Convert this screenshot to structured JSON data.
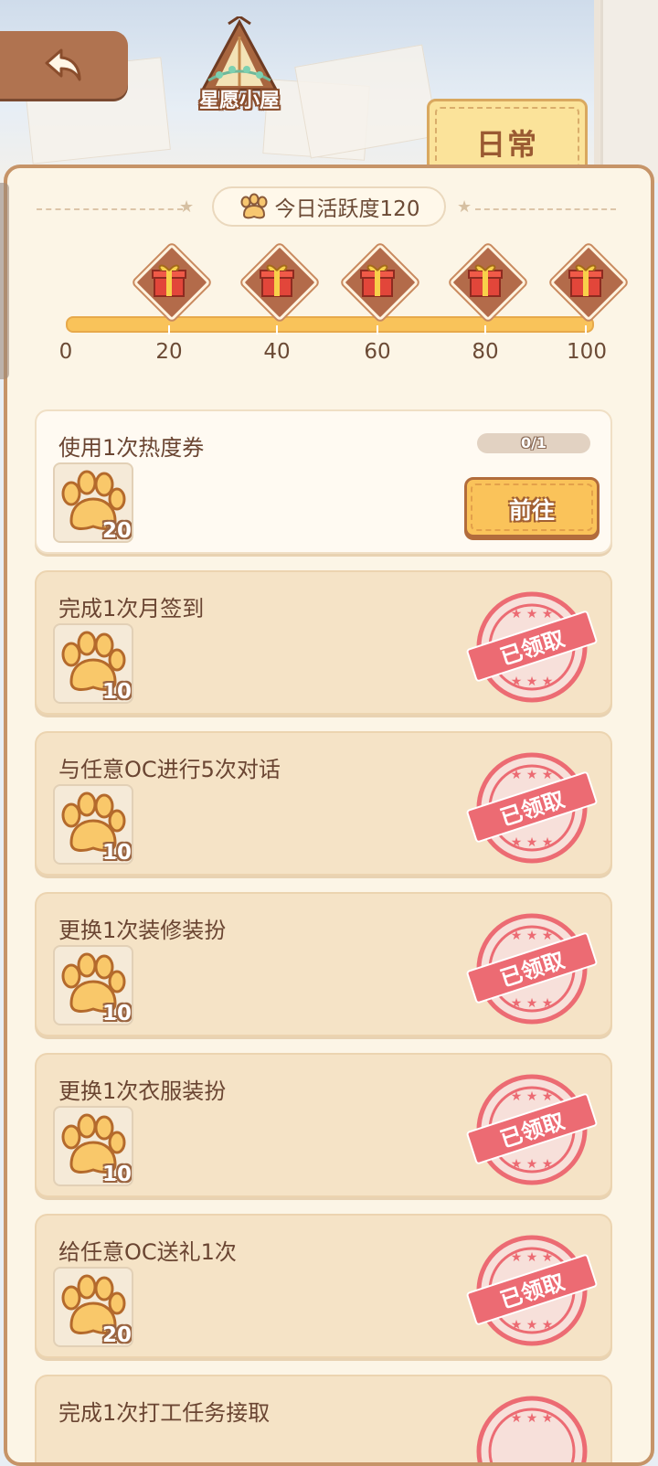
{
  "header": {
    "back_icon": "back-arrow-icon",
    "logo_text": "星愿小屋",
    "tab_label": "日常"
  },
  "activity": {
    "label": "今日活跃度120",
    "progress": 1.0,
    "milestones": [
      "20",
      "40",
      "60",
      "80",
      "100"
    ],
    "start_label": "0"
  },
  "tasks": [
    {
      "title": "使用1次热度券",
      "reward": "20",
      "status": "active",
      "progress": "0/1",
      "button": "前往"
    },
    {
      "title": "完成1次月签到",
      "reward": "10",
      "status": "claimed",
      "stamp": "已领取"
    },
    {
      "title": "与任意OC进行5次对话",
      "reward": "10",
      "status": "claimed",
      "stamp": "已领取"
    },
    {
      "title": "更换1次装修装扮",
      "reward": "10",
      "status": "claimed",
      "stamp": "已领取"
    },
    {
      "title": "更换1次衣服装扮",
      "reward": "10",
      "status": "claimed",
      "stamp": "已领取"
    },
    {
      "title": "给任意OC送礼1次",
      "reward": "20",
      "status": "claimed",
      "stamp": "已领取"
    },
    {
      "title": "完成1次打工任务接取",
      "reward": "",
      "status": "claimed",
      "stamp": ""
    }
  ],
  "colors": {
    "panel_bg": "#fcf5e6",
    "accent": "#fac35a",
    "stamp": "#ec6b73",
    "text": "#6a4532"
  }
}
